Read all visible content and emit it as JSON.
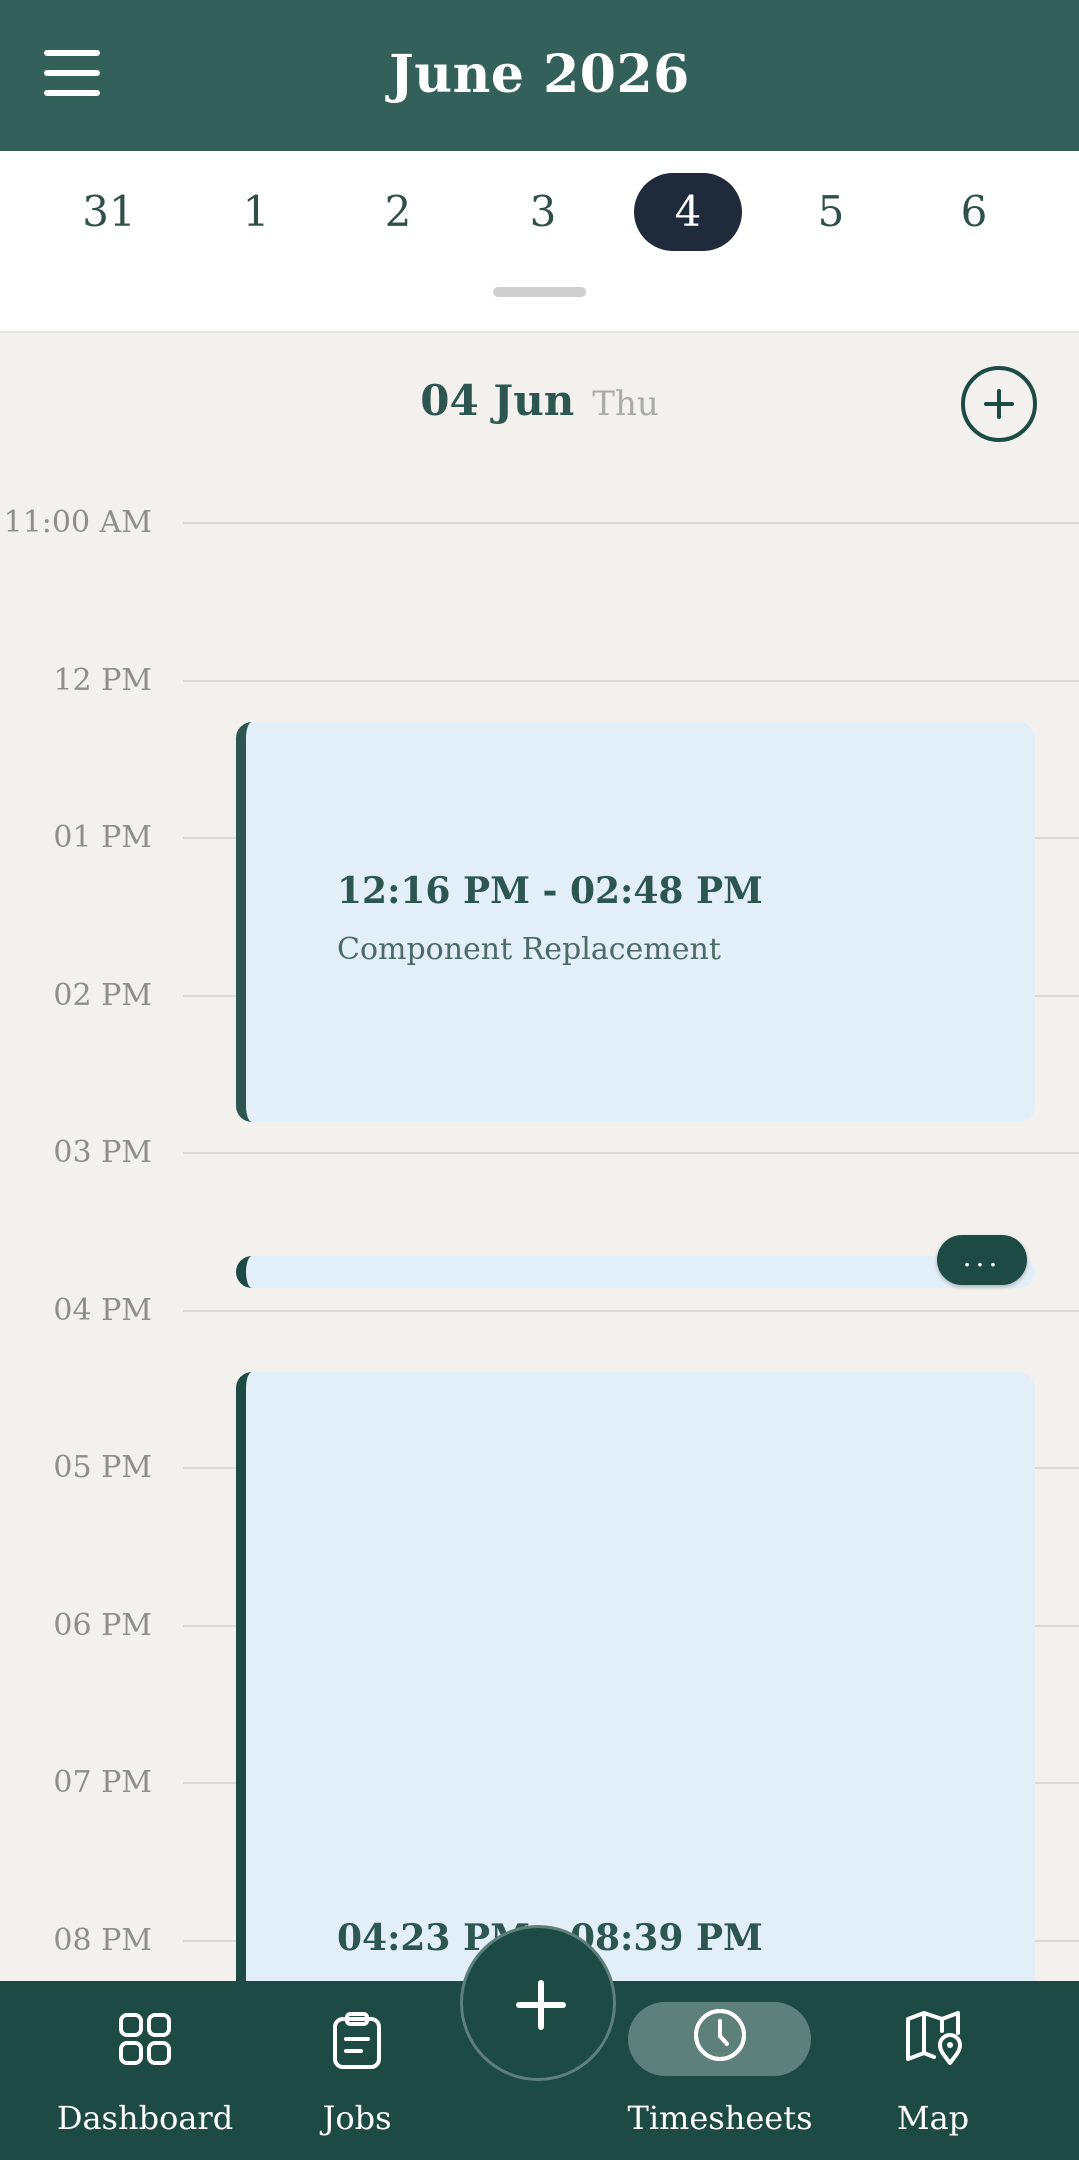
{
  "header": {
    "title": "June 2026",
    "menu_icon": "hamburger-menu-icon"
  },
  "week": {
    "days": [
      "31",
      "1",
      "2",
      "3",
      "4",
      "5",
      "6"
    ],
    "selected": "4"
  },
  "date_heading": {
    "date": "04 Jun",
    "weekday": "Thu",
    "add_icon": "plus-circle-icon"
  },
  "timeline": {
    "hours": [
      "11:00 AM",
      "12 PM",
      "01 PM",
      "02 PM",
      "03 PM",
      "04 PM",
      "05 PM",
      "06 PM",
      "07 PM",
      "08 PM"
    ]
  },
  "events": [
    {
      "time": "12:16 PM - 02:48 PM",
      "title": "Component Replacement"
    },
    {
      "time": "",
      "title": ""
    },
    {
      "time": "04:23 PM - 08:39 PM",
      "title": ""
    }
  ],
  "more_label": "...",
  "bottom_nav": {
    "items": [
      {
        "label": "Dashboard",
        "icon": "grid-icon"
      },
      {
        "label": "Jobs",
        "icon": "clipboard-icon"
      },
      {
        "label": "Timesheets",
        "icon": "clock-icon",
        "active": true
      },
      {
        "label": "Map",
        "icon": "map-pin-icon"
      }
    ],
    "fab_icon": "plus-icon"
  },
  "colors": {
    "header": "#336159",
    "nav": "#1e4a44",
    "event_bg": "#e2eff9",
    "selected_day": "#1f2b3b"
  }
}
